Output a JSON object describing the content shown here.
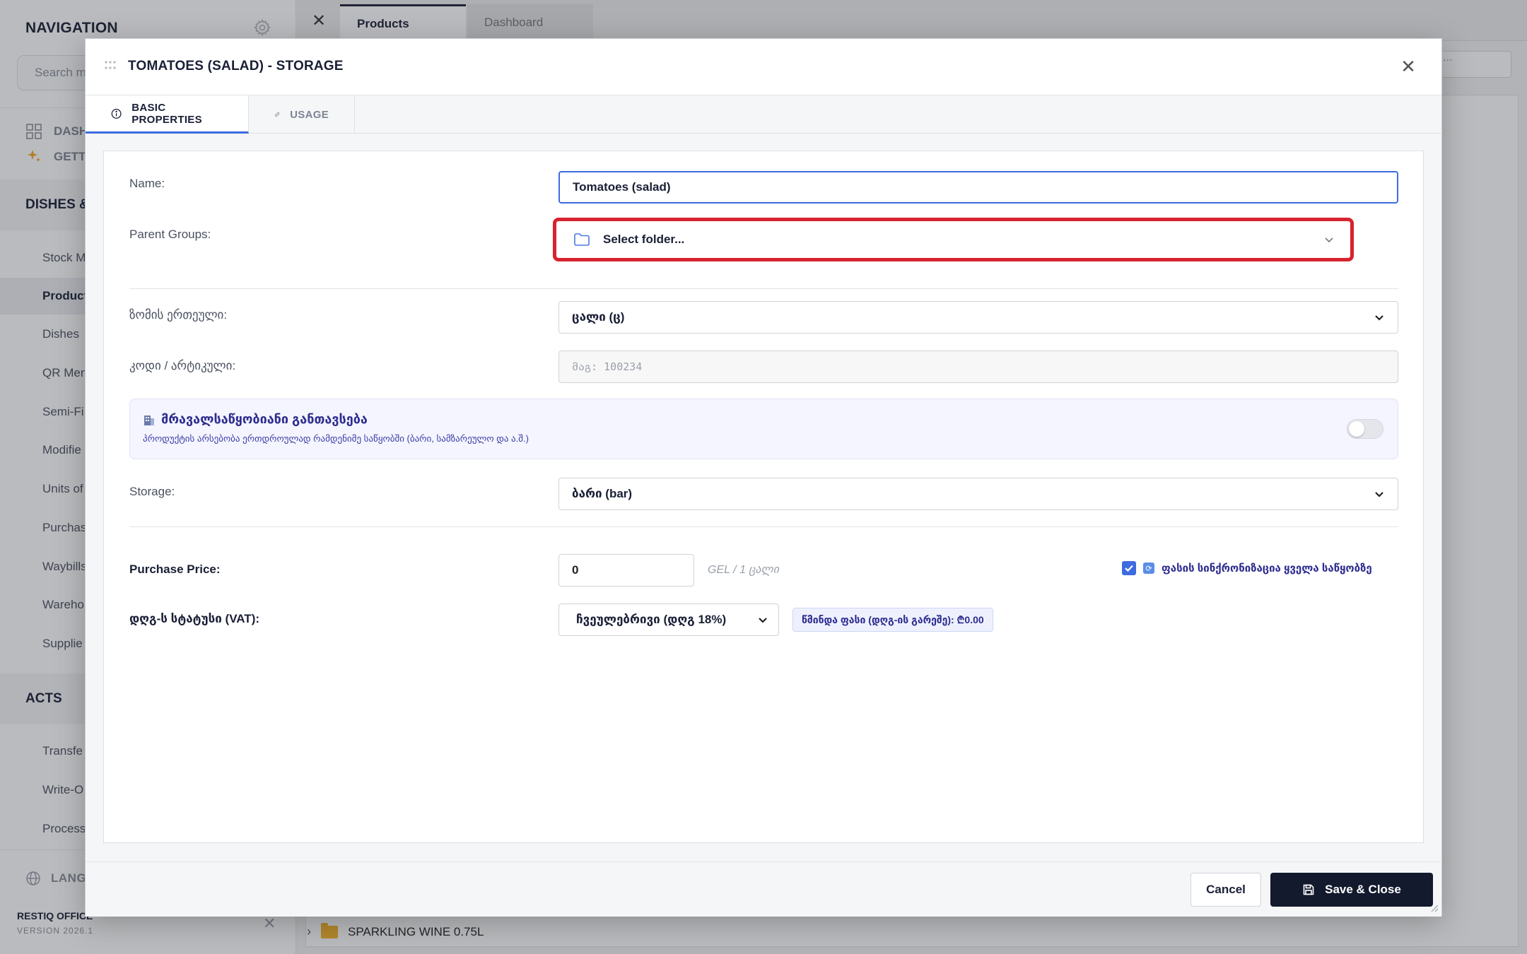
{
  "sidebar": {
    "title": "NAVIGATION",
    "search_placeholder": "Search m",
    "quick": [
      {
        "label": "DASH",
        "icon": "dashboard-grid-icon"
      },
      {
        "label": "GETTI",
        "icon": "sparkle-icon"
      }
    ],
    "sections": [
      {
        "label": "DISHES &"
      },
      {
        "label": "ACTS"
      }
    ],
    "items": [
      {
        "label": "Stock M"
      },
      {
        "label": "Product",
        "active": true
      },
      {
        "label": "Dishes"
      },
      {
        "label": "QR Men"
      },
      {
        "label": "Semi-Fi"
      },
      {
        "label": "Modifie"
      },
      {
        "label": "Units of"
      },
      {
        "label": "Purchas"
      },
      {
        "label": "Waybills"
      },
      {
        "label": "Wareho"
      },
      {
        "label": "Supplie"
      }
    ],
    "acts_items": [
      {
        "label": "Transfe"
      },
      {
        "label": "Write-O"
      },
      {
        "label": "Processi"
      }
    ],
    "language_label": "LANGU",
    "brand": "RESTIQ OFFICE",
    "version": "VERSION 2026.1"
  },
  "tabs": {
    "active": "Products",
    "inactive": "Dashboard"
  },
  "background": {
    "search_placeholder": "...",
    "row_label": "SPARKLING WINE 0.75L"
  },
  "modal": {
    "title": "TOMATOES (SALAD) - STORAGE",
    "tabs": [
      {
        "label": "BASIC PROPERTIES",
        "icon": "info-icon",
        "active": true
      },
      {
        "label": "USAGE",
        "icon": "link-icon",
        "active": false
      }
    ],
    "form": {
      "name_label": "Name:",
      "name_value": "Tomatoes (salad)",
      "parent_label": "Parent Groups:",
      "parent_placeholder": "Select folder...",
      "unit_label": "ზომის ერთეული:",
      "unit_value": "ცალი (ც)",
      "code_label": "კოდი / არტიკული:",
      "code_placeholder": "მაგ: 100234",
      "multi_title": "მრავალსაწყობიანი განთავსება",
      "multi_desc": "პროდუქტის არსებობა ერთდროულად რამდენიმე საწყობში (ბარი, სამზარეულო და ა.შ.)",
      "multi_enabled": false,
      "storage_label": "Storage:",
      "storage_value": "ბარი (bar)",
      "price_label": "Purchase Price:",
      "price_value": "0",
      "price_unit": "GEL / 1 ცალი",
      "sync_label": "ფასის სინქრონიზაცია ყველა საწყობზე",
      "sync_checked": true,
      "vat_label": "დღგ-ს სტატუსი (VAT):",
      "vat_value": "ჩვეულებრივი (დღგ 18%)",
      "net_price": "წმინდა ფასი (დღგ-ის გარეშე): ₾0.00"
    },
    "footer": {
      "cancel": "Cancel",
      "save": "Save & Close"
    }
  },
  "colors": {
    "accent": "#3d6be0",
    "highlight": "#d7232e",
    "dark_button": "#131a2e",
    "georgian_text": "#2d2c8f"
  }
}
